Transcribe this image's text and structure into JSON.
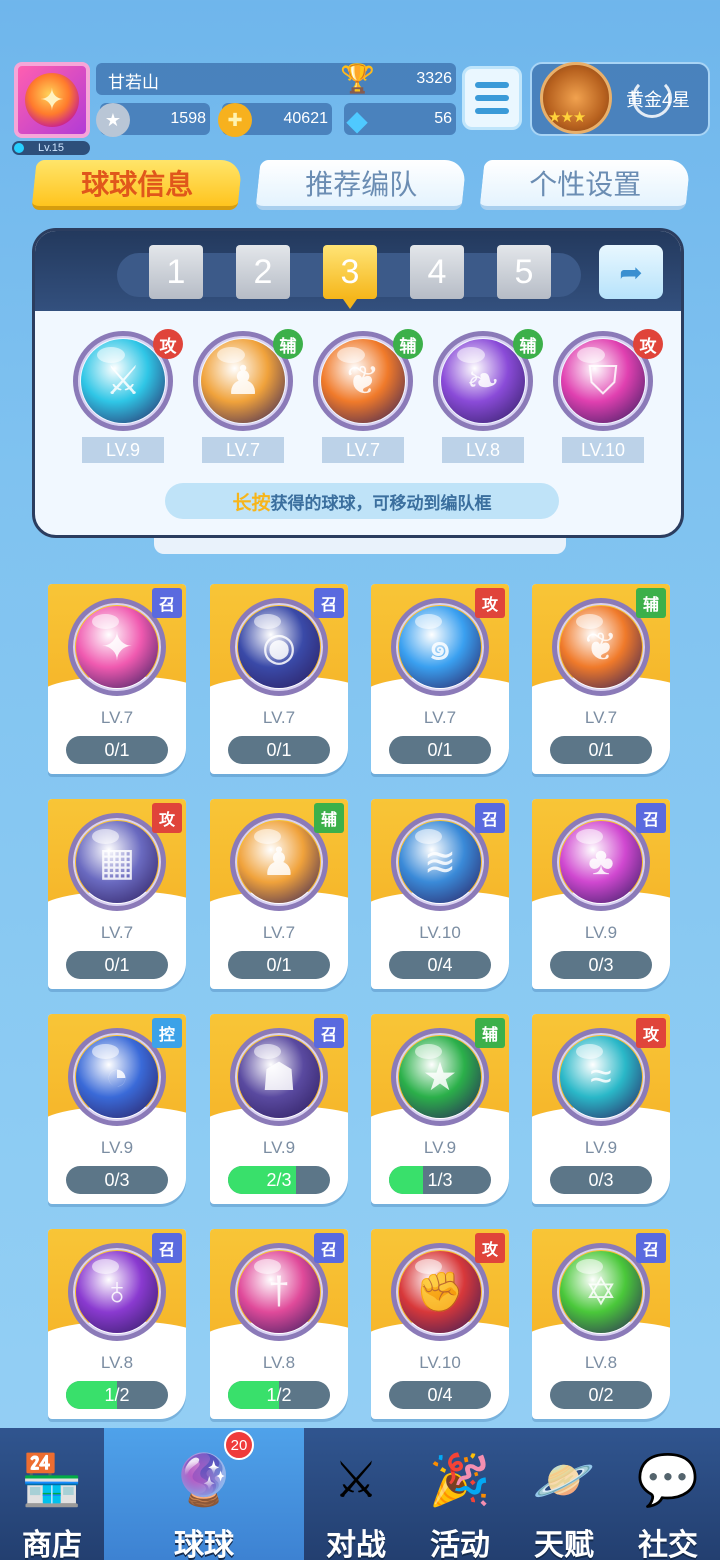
{
  "player": {
    "name": "甘若山",
    "level": "Lv.15",
    "trophies": "3326",
    "silver": "1598",
    "gold": "40621",
    "diamonds": "56",
    "rank_text": "黄金4星"
  },
  "tabs": [
    {
      "label": "球球信息",
      "active": true
    },
    {
      "label": "推荐编队",
      "active": false
    },
    {
      "label": "个性设置",
      "active": false
    }
  ],
  "team": {
    "slots": [
      "1",
      "2",
      "3",
      "4",
      "5"
    ],
    "active_slot": "3",
    "balls": [
      {
        "icon": "sword-ball-icon",
        "type": "攻",
        "level": "LV.9",
        "color": "#2fc6e6"
      },
      {
        "icon": "figures-ball-icon",
        "type": "辅",
        "level": "LV.7",
        "color": "#f0a23b"
      },
      {
        "icon": "wings-ball-icon",
        "type": "辅",
        "level": "LV.7",
        "color": "#f07a2a"
      },
      {
        "icon": "leaf-ball-icon",
        "type": "辅",
        "level": "LV.8",
        "color": "#8a4bd8"
      },
      {
        "icon": "shield-ball-icon",
        "type": "攻",
        "level": "LV.10",
        "color": "#e040b0"
      }
    ],
    "hint_highlight": "长按",
    "hint_rest": "获得的球球，可移动到编队框"
  },
  "grid": [
    {
      "icon": "phoenix-ball-icon",
      "type": "召",
      "level": "LV.7",
      "progress": "0/1",
      "fill": 0,
      "color": "#f05ab0"
    },
    {
      "icon": "vortex-ball-icon",
      "type": "召",
      "level": "LV.7",
      "progress": "0/1",
      "fill": 0,
      "color": "#3a4aa8"
    },
    {
      "icon": "swirl-ball-icon",
      "type": "攻",
      "level": "LV.7",
      "progress": "0/1",
      "fill": 0,
      "color": "#3aa0f0"
    },
    {
      "icon": "wings-ball-icon",
      "type": "辅",
      "level": "LV.7",
      "progress": "0/1",
      "fill": 0,
      "color": "#f07a2a"
    },
    {
      "icon": "pixel-ball-icon",
      "type": "攻",
      "level": "LV.7",
      "progress": "0/1",
      "fill": 0,
      "color": "#6a6ac0"
    },
    {
      "icon": "figures-ball-icon",
      "type": "辅",
      "level": "LV.7",
      "progress": "0/1",
      "fill": 0,
      "color": "#f0a23b"
    },
    {
      "icon": "wind-ball-icon",
      "type": "召",
      "level": "LV.10",
      "progress": "0/4",
      "fill": 0,
      "color": "#3a8ad8"
    },
    {
      "icon": "mushroom-ball-icon",
      "type": "召",
      "level": "LV.9",
      "progress": "0/3",
      "fill": 0,
      "color": "#d048d0"
    },
    {
      "icon": "clock-ball-icon",
      "type": "控",
      "level": "LV.9",
      "progress": "0/3",
      "fill": 0,
      "color": "#3a6ad8"
    },
    {
      "icon": "ghost-ball-icon",
      "type": "召",
      "level": "LV.9",
      "progress": "2/3",
      "fill": 0.67,
      "color": "#5a4aa0"
    },
    {
      "icon": "star-arrow-ball-icon",
      "type": "辅",
      "level": "LV.9",
      "progress": "1/3",
      "fill": 0.33,
      "color": "#2bb04a"
    },
    {
      "icon": "tornado-ball-icon",
      "type": "攻",
      "level": "LV.9",
      "progress": "0/3",
      "fill": 0,
      "color": "#2ab8c8"
    },
    {
      "icon": "planet-ball-icon",
      "type": "召",
      "level": "LV.8",
      "progress": "1/2",
      "fill": 0.5,
      "color": "#8a3ad0"
    },
    {
      "icon": "dagger-ball-icon",
      "type": "召",
      "level": "LV.8",
      "progress": "1/2",
      "fill": 0.5,
      "color": "#e04a9a"
    },
    {
      "icon": "fist-ball-icon",
      "type": "攻",
      "level": "LV.10",
      "progress": "0/4",
      "fill": 0,
      "color": "#d8383a"
    },
    {
      "icon": "hexagram-ball-icon",
      "type": "召",
      "level": "LV.8",
      "progress": "0/2",
      "fill": 0,
      "color": "#4ac83a"
    }
  ],
  "nav": [
    {
      "label": "商店",
      "icon": "shop-icon",
      "active": false
    },
    {
      "label": "球球",
      "icon": "balls-icon",
      "active": true,
      "badge": "20"
    },
    {
      "label": "对战",
      "icon": "crossed-swords-icon",
      "active": false
    },
    {
      "label": "活动",
      "icon": "party-popper-icon",
      "active": false
    },
    {
      "label": "天赋",
      "icon": "talent-planet-icon",
      "active": false
    },
    {
      "label": "社交",
      "icon": "social-phone-icon",
      "active": false
    }
  ],
  "type_colors": {
    "攻": "#e0443a",
    "辅": "#3cb04a",
    "召": "#5a6adf",
    "控": "#3ba2e8"
  }
}
